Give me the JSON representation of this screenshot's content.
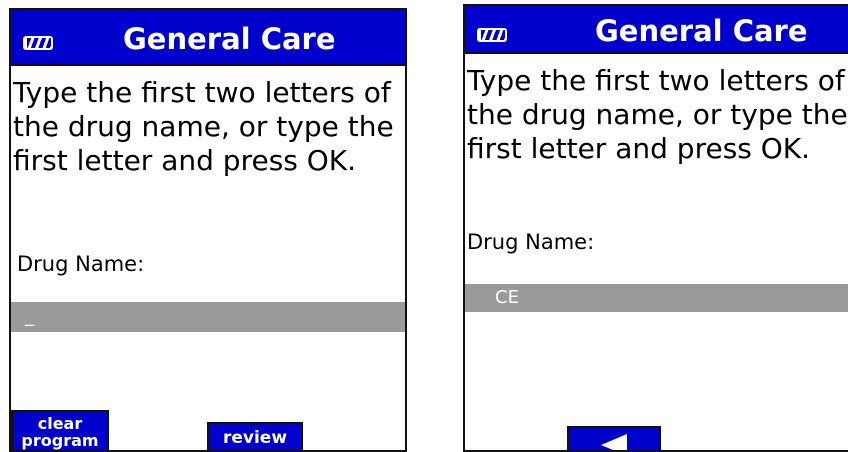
{
  "screens": [
    {
      "header": {
        "title": "General Care",
        "battery_icon": "battery-icon"
      },
      "instructions": "Type the first two letters of the drug name, or type the first letter and press OK.",
      "drug_label": "Drug Name:",
      "drug_input_value": "_",
      "buttons": {
        "clear_program": "clear program",
        "review": "review"
      }
    },
    {
      "header": {
        "title": "General Care",
        "battery_icon": "battery-icon"
      },
      "instructions": "Type the first two letters of the drug name, or type the first letter and press OK.",
      "drug_label": "Drug Name:",
      "drug_input_value": "CE",
      "buttons": {
        "back_icon": "left-triangle-icon"
      }
    }
  ],
  "colors": {
    "header_blue": "#0000cc",
    "input_gray": "#9a9a9a",
    "text": "#000000",
    "button_text": "#ffffff"
  }
}
